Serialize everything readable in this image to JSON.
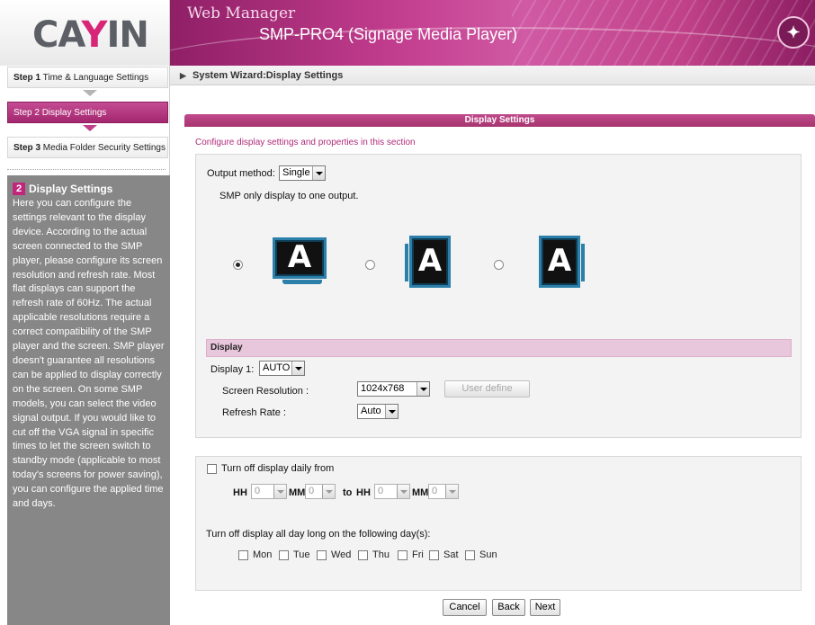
{
  "header": {
    "logo": "CAYIN",
    "app_title": "Web Manager",
    "model": "SMP-PRO4 (Signage Media Player)"
  },
  "sidebar": {
    "steps": [
      {
        "num": "Step 1",
        "label": "Time & Language Settings"
      },
      {
        "num": "Step 2",
        "label": "Display Settings"
      },
      {
        "num": "Step 3",
        "label": "Media Folder Security Settings"
      }
    ],
    "help": {
      "number": "2",
      "title": "Display Settings",
      "body": "Here you can configure the settings relevant to the display device. According to the actual screen connected to the SMP player, please configure its screen resolution and refresh rate. Most flat displays can support the refresh rate of 60Hz. The actual applicable resolutions require a correct compatibility of the SMP player and the screen. SMP player doesn't guarantee all resolutions can be applied to display correctly on the screen. On some SMP models, you can select the video signal output. If you would like to cut off the VGA signal in specific times to let the screen switch to standby mode (applicable to most today's screens for power saving), you can configure the applied time and days."
    }
  },
  "breadcrumb": "System Wizard:Display Settings",
  "section": {
    "title": "Display Settings",
    "description": "Configure display settings and properties in this section"
  },
  "output": {
    "label": "Output method:",
    "value": "Single",
    "note": "SMP only display to one output.",
    "orientations": [
      {
        "glyph": "A",
        "selected": true
      },
      {
        "glyph": "A",
        "selected": false
      },
      {
        "glyph": "A",
        "selected": false
      }
    ]
  },
  "display": {
    "header": "Display",
    "display1_label": "Display 1:",
    "display1_value": "AUTO",
    "resolution_label": "Screen Resolution :",
    "resolution_value": "1024x768",
    "user_define": "User define",
    "refresh_label": "Refresh Rate :",
    "refresh_value": "Auto"
  },
  "schedule": {
    "turn_off_label": "Turn off display daily from",
    "hh": "HH",
    "mm": "MM",
    "to": "to",
    "zero": "0",
    "all_day_label": "Turn off display all day long on the following day(s):",
    "days": [
      "Mon",
      "Tue",
      "Wed",
      "Thu",
      "Fri",
      "Sat",
      "Sun"
    ]
  },
  "buttons": {
    "cancel": "Cancel",
    "back": "Back",
    "next": "Next"
  }
}
